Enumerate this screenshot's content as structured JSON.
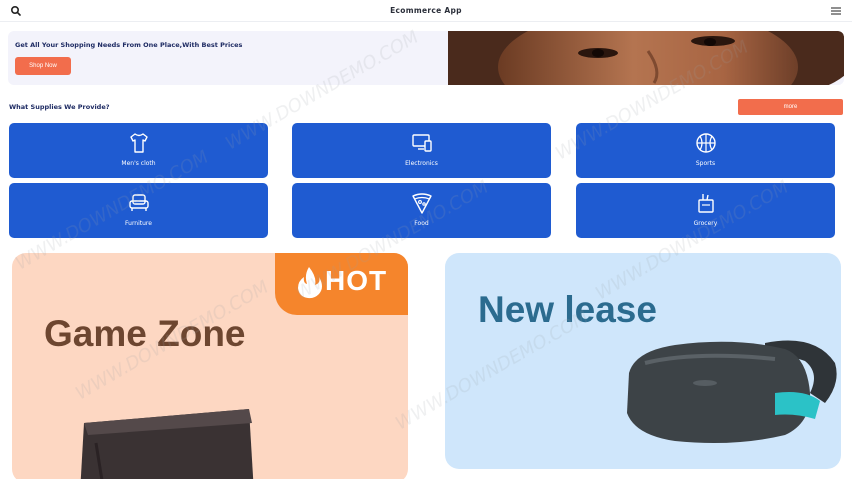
{
  "app": {
    "title": "Ecommerce App"
  },
  "hero": {
    "headline": "Get All Your Shopping Needs From One Place,With Best Prices",
    "cta_label": "Shop Now"
  },
  "section": {
    "title": "What Supplies We Provide?",
    "more_label": "more"
  },
  "categories": [
    {
      "label": "Men's cloth",
      "icon": "shirt-icon"
    },
    {
      "label": "Electronics",
      "icon": "devices-icon"
    },
    {
      "label": "Sports",
      "icon": "basketball-icon"
    },
    {
      "label": "Furniture",
      "icon": "armchair-icon"
    },
    {
      "label": "Food",
      "icon": "pizza-icon"
    },
    {
      "label": "Grocery",
      "icon": "grocery-bag-icon"
    }
  ],
  "promos": [
    {
      "badge": "HOT",
      "title": "Game Zone"
    },
    {
      "title": "New lease"
    }
  ],
  "watermark": "WWW.DOWNDEMO.COM",
  "colors": {
    "accent": "#f26d4c",
    "category_tile": "#1f5bd1",
    "game_bg": "#fdd7c2",
    "lease_bg": "#cfe6fb",
    "hot_badge": "#f5852c"
  }
}
